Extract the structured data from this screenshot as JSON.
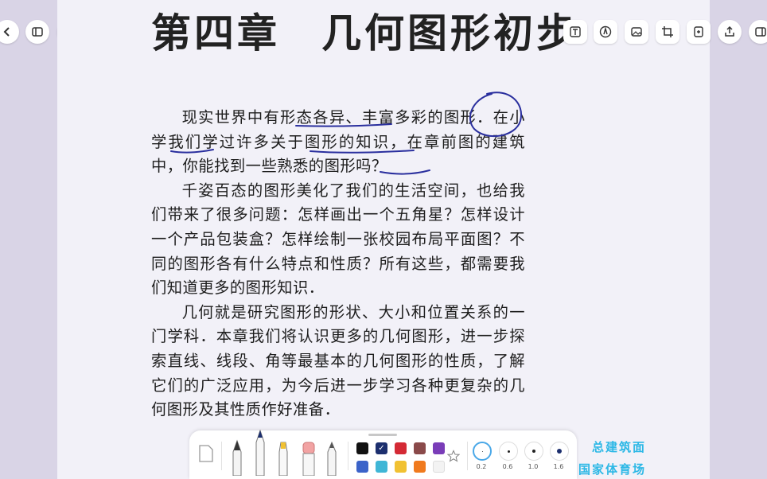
{
  "chapter_title": {
    "part1": "第四章",
    "part2": "几何图形初步"
  },
  "paragraphs": [
    "现实世界中有形态各异、丰富多彩的图形．在小学我们学过许多关于图形的知识，在章前图的建筑中，你能找到一些熟悉的图形吗？",
    "千姿百态的图形美化了我们的生活空间，也给我们带来了很多问题：怎样画出一个五角星？怎样设计一个产品包装盒？怎样绘制一张校园布局平面图？不同的图形各有什么特点和性质？所有这些，都需要我们知道更多的图形知识．",
    "几何就是研究图形的形状、大小和位置关系的一门学科．本章我们将认识更多的几何图形，进一步探索直线、线段、角等最基本的几何图形的性质，了解它们的广泛应用，为今后进一步学习各种更复杂的几何图形及其性质作好准备．"
  ],
  "watermark": {
    "line1": "总建筑面",
    "line2": "国家体育场"
  },
  "pen_sizes": [
    "0.2",
    "0.6",
    "1.0",
    "1.6"
  ],
  "colors": {
    "row1": [
      "#111111",
      "#1c2f6e",
      "#d42a35",
      "#8a4a4a",
      "#7a3db8"
    ],
    "row2": [
      "#3b63c9",
      "#3fb6d6",
      "#f1c132",
      "#f07a1e",
      "#f3f3f3"
    ],
    "accent": "#2db8e6",
    "annotation": "#2a2f9e"
  },
  "icons": {
    "left": [
      "back-icon",
      "sidebar-icon",
      "grid-icon",
      "undo-icon",
      "redo-icon"
    ],
    "right": [
      "text-box-icon",
      "pen-circle-icon",
      "image-icon",
      "crop-icon",
      "page-add-icon",
      "share-icon",
      "panel-icon"
    ]
  }
}
